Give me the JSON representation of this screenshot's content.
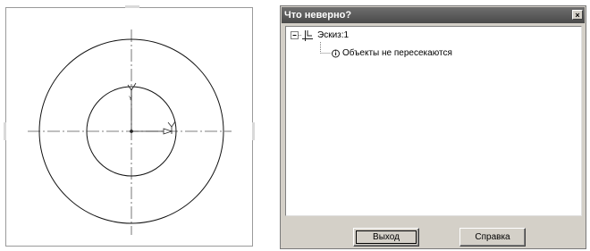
{
  "dialog": {
    "title": "Что неверно?",
    "close_glyph": "×",
    "tree": {
      "root_label": "Эскиз:1",
      "root_icon": "sketch-icon",
      "expander": "minus",
      "child_label": "Объекты не пересекаются",
      "child_icon": "info-icon"
    },
    "buttons": {
      "exit_label": "Выход",
      "help_label": "Справка"
    }
  },
  "sketch": {
    "objects": [
      "outer-circle",
      "inner-circle",
      "centerline-horizontal",
      "centerline-vertical",
      "coordinate-axes"
    ]
  },
  "colors": {
    "dialog_face": "#d4d0c8",
    "titlebar": "#4a4a4a"
  }
}
